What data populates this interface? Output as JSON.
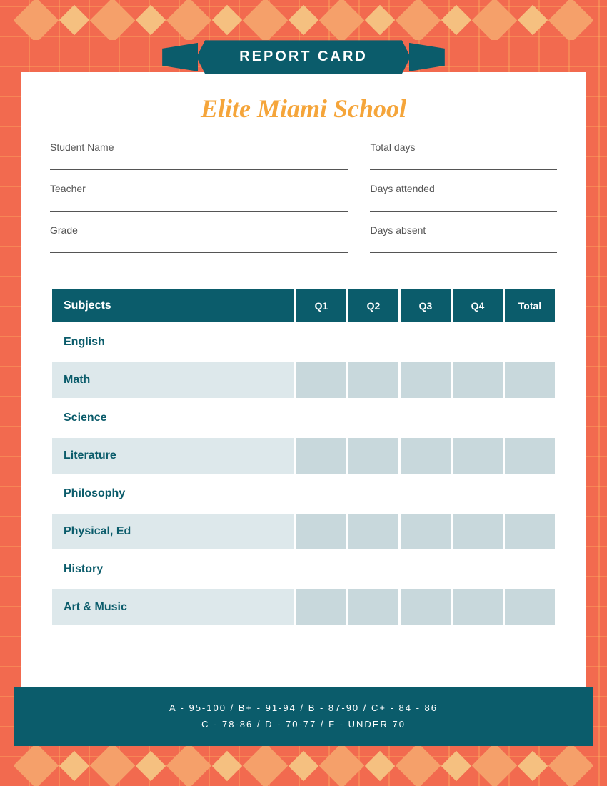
{
  "header": {
    "banner_label": "REPORT CARD",
    "school_name": "Elite Miami School"
  },
  "info": {
    "student_name_label": "Student Name",
    "teacher_label": "Teacher",
    "grade_label": "Grade",
    "total_days_label": "Total days",
    "days_attended_label": "Days attended",
    "days_absent_label": "Days absent"
  },
  "table": {
    "headers": [
      "Subjects",
      "Q1",
      "Q2",
      "Q3",
      "Q4",
      "Total"
    ],
    "rows": [
      {
        "subject": "English",
        "shaded": false
      },
      {
        "subject": "Math",
        "shaded": true
      },
      {
        "subject": "Science",
        "shaded": false
      },
      {
        "subject": "Literature",
        "shaded": true
      },
      {
        "subject": "Philosophy",
        "shaded": false
      },
      {
        "subject": "Physical, Ed",
        "shaded": true
      },
      {
        "subject": "History",
        "shaded": false
      },
      {
        "subject": "Art & Music",
        "shaded": true
      }
    ]
  },
  "footer": {
    "line1": "A - 95-100  /  B+ - 91-94  /  B - 87-90  /  C+ - 84 - 86",
    "line2": "C - 78-86  /  D - 70-77  /  F - UNDER 70"
  }
}
